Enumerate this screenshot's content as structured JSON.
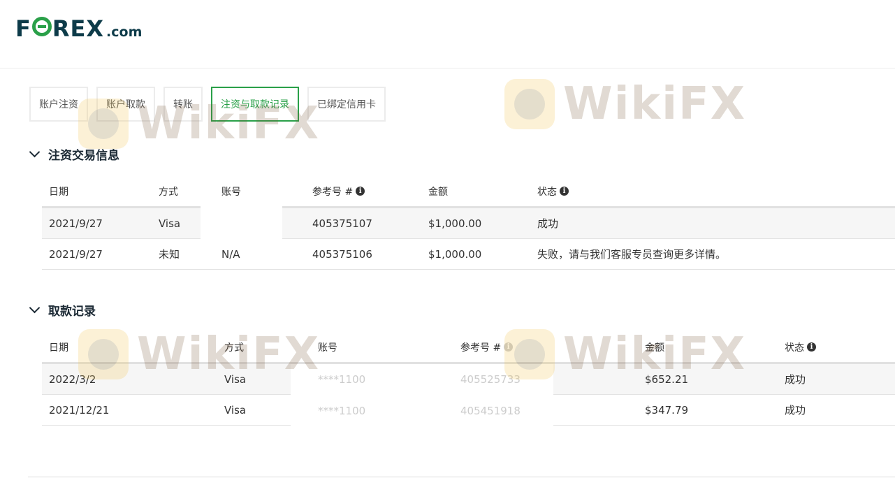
{
  "brand": {
    "logo_f": "F",
    "logo_rest": "REX",
    "logo_suffix": ".com",
    "primary_color": "#0d3b49",
    "accent_color": "#2aa049"
  },
  "tabs": [
    {
      "label": "账户注资"
    },
    {
      "label": "账户取款"
    },
    {
      "label": "转账"
    },
    {
      "label": "注资与取款记录",
      "active": true
    },
    {
      "label": "已绑定信用卡"
    }
  ],
  "deposits": {
    "title": "注资交易信息",
    "headers": {
      "date": "日期",
      "method": "方式",
      "account": "账号",
      "ref": "参考号 #",
      "amount": "金额",
      "status": "状态"
    },
    "rows": [
      {
        "date": "2021/9/27",
        "method": "Visa",
        "account": "",
        "ref": "405375107",
        "amount": "$1,000.00",
        "status": "成功"
      },
      {
        "date": "2021/9/27",
        "method": "未知",
        "account": "N/A",
        "ref": "405375106",
        "amount": "$1,000.00",
        "status": "失败，请与我们客服专员查询更多详情。"
      }
    ]
  },
  "withdrawals": {
    "title": "取款记录",
    "headers": {
      "date": "日期",
      "method": "方式",
      "account": "账号",
      "ref": "参考号 #",
      "amount": "金额",
      "status": "状态"
    },
    "rows": [
      {
        "date": "2022/3/2",
        "method": "Visa",
        "account": "****1100",
        "ref": "405525733",
        "amount": "$652.21",
        "status": "成功"
      },
      {
        "date": "2021/12/21",
        "method": "Visa",
        "account": "****1100",
        "ref": "405451918",
        "amount": "$347.79",
        "status": "成功"
      }
    ]
  },
  "watermark": {
    "text": "WikiFX"
  }
}
